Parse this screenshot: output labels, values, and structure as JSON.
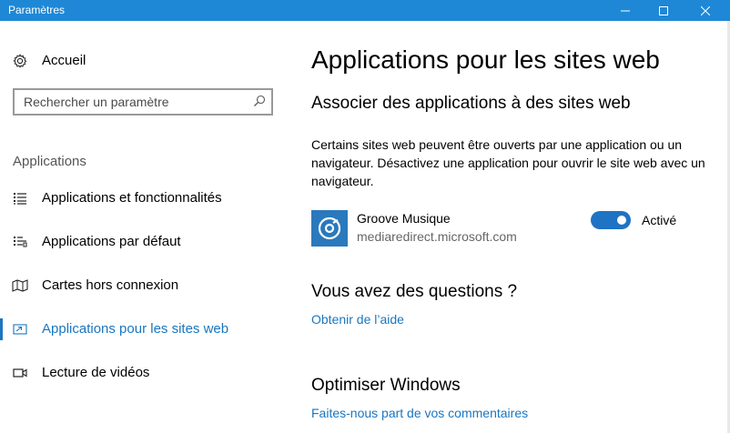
{
  "window": {
    "title": "Paramètres"
  },
  "sidebar": {
    "home_label": "Accueil",
    "search_placeholder": "Rechercher un paramètre",
    "section_label": "Applications",
    "items": [
      {
        "label": "Applications et fonctionnalités",
        "icon": "list-icon"
      },
      {
        "label": "Applications par défaut",
        "icon": "default-apps-icon"
      },
      {
        "label": "Cartes hors connexion",
        "icon": "map-icon"
      },
      {
        "label": "Applications pour les sites web",
        "icon": "open-in-icon",
        "active": true
      },
      {
        "label": "Lecture de vidéos",
        "icon": "video-icon"
      }
    ]
  },
  "main": {
    "title": "Applications pour les sites web",
    "subtitle": "Associer des applications à des sites web",
    "description": "Certains sites web peuvent être ouverts par une application ou un navigateur. Désactivez une application pour ouvrir le site web avec un navigateur.",
    "app": {
      "name": "Groove Musique",
      "domain": "mediaredirect.microsoft.com",
      "toggle_state": "Activé",
      "enabled": true
    },
    "questions_heading": "Vous avez des questions ?",
    "help_link": "Obtenir de l’aide",
    "optimize_heading": "Optimiser Windows",
    "feedback_link": "Faites-nous part de vos commentaires"
  },
  "colors": {
    "titlebar": "#1e88d6",
    "accent": "#1a76c0",
    "app_tile": "#2a79bd"
  }
}
